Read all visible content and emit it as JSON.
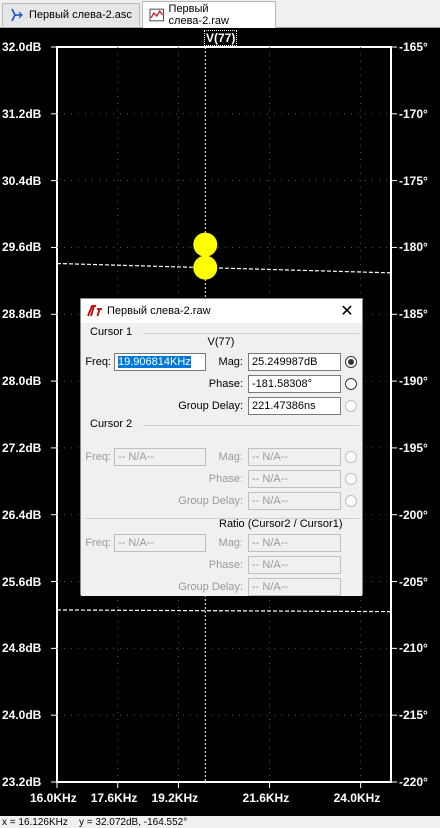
{
  "tabs": [
    {
      "label": "Первый слева-2.asc",
      "icon": "schematic-icon"
    },
    {
      "label": "Первый слева-2.raw",
      "icon": "waveform-icon"
    }
  ],
  "plot": {
    "trace_name": "V(77)",
    "left_ticks": [
      "32.0dB",
      "31.2dB",
      "30.4dB",
      "29.6dB",
      "28.8dB",
      "28.0dB",
      "27.2dB",
      "26.4dB",
      "25.6dB",
      "24.8dB",
      "24.0dB",
      "23.2dB"
    ],
    "right_ticks": [
      "-165°",
      "-170°",
      "-175°",
      "-180°",
      "-185°",
      "-190°",
      "-195°",
      "-200°",
      "-205°",
      "-210°",
      "-215°",
      "-220°"
    ],
    "x_ticks": [
      "16.0KHz",
      "17.6KHz",
      "19.2KHz",
      "21.6KHz",
      "24.0KHz"
    ],
    "colors": {
      "axis": "#ffffff",
      "cursor_marker": "#ffff00",
      "background": "#000000"
    }
  },
  "chart_data": {
    "type": "line",
    "xlabel": "",
    "ylabel": "",
    "x_ticks": [
      "16.0KHz",
      "17.6KHz",
      "19.2KHz",
      "21.6KHz",
      "24.0KHz"
    ],
    "y_left_ticks": [
      "32.0dB",
      "31.2dB",
      "30.4dB",
      "29.6dB",
      "28.8dB",
      "28.0dB",
      "27.2dB",
      "26.4dB",
      "25.6dB",
      "24.8dB",
      "24.0dB",
      "23.2dB"
    ],
    "y_right_ticks": [
      "-165°",
      "-170°",
      "-175°",
      "-180°",
      "-185°",
      "-190°",
      "-195°",
      "-200°",
      "-205°",
      "-210°",
      "-215°",
      "-220°"
    ],
    "xlim": [
      16.0,
      24.8
    ],
    "ylim": [
      23.2,
      32.0
    ],
    "y2lim": [
      -220,
      -165
    ],
    "grid": true,
    "series": [
      {
        "name": "V(77)",
        "axis": "phase",
        "style": "dashed",
        "x": [
          16.0,
          24.8
        ],
        "y": [
          -181.2,
          -181.9
        ]
      },
      {
        "name": "V(77)",
        "axis": "magnitude",
        "style": "dashed",
        "x": [
          16.0,
          24.8
        ],
        "y": [
          25.26,
          25.24
        ]
      }
    ],
    "cursor": {
      "freq_khz": 19.906814,
      "mag_db": 25.249987,
      "phase_deg": -181.58308
    }
  },
  "dialog": {
    "title": "Первый слева-2.raw",
    "cursor1": {
      "label": "Cursor 1",
      "trace": "V(77)",
      "freq_label": "Freq:",
      "freq_value": "19.906814KHz",
      "mag_label": "Mag:",
      "mag_value": "25.249987dB",
      "phase_label": "Phase:",
      "phase_value": "-181.58308°",
      "gd_label": "Group Delay:",
      "gd_value": "221.47386ns"
    },
    "cursor2": {
      "label": "Cursor 2",
      "freq_label": "Freq:",
      "freq_value": "-- N/A--",
      "mag_label": "Mag:",
      "mag_value": "-- N/A--",
      "phase_label": "Phase:",
      "phase_value": "-- N/A--",
      "gd_label": "Group Delay:",
      "gd_value": "-- N/A--"
    },
    "ratio": {
      "label": "Ratio (Cursor2 / Cursor1)",
      "freq_label": "Freq:",
      "freq_value": "-- N/A--",
      "mag_label": "Mag:",
      "mag_value": "-- N/A--",
      "phase_label": "Phase:",
      "phase_value": "-- N/A--",
      "gd_label": "Group Delay:",
      "gd_value": "-- N/A--"
    }
  },
  "status": {
    "text": "x = 16.126KHz    y = 32.072dB, -164.552°"
  }
}
